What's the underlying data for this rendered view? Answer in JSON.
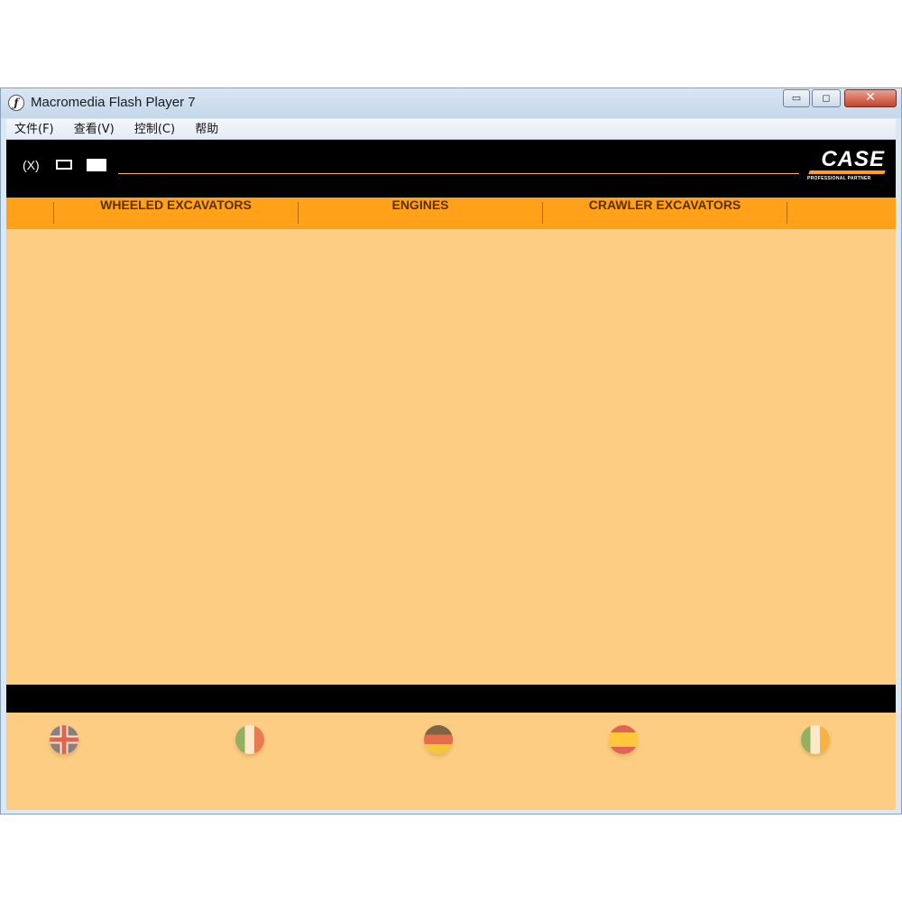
{
  "window": {
    "title": "Macromedia Flash Player 7",
    "minimize_glyph": "▭",
    "maximize_glyph": "◻",
    "close_glyph": "✕"
  },
  "menubar": {
    "items": [
      "文件(F)",
      "查看(V)",
      "控制(C)",
      "帮助"
    ]
  },
  "header": {
    "close_label": "(X)",
    "icons": [
      "fit-screen-icon",
      "fullscreen-icon"
    ],
    "logo_text": "CASE",
    "logo_subtext": "PROFESSIONAL PARTNER"
  },
  "nav": {
    "tabs": [
      "WHEELED EXCAVATORS",
      "ENGINES",
      "CRAWLER EXCAVATORS"
    ]
  },
  "languages": [
    {
      "icon": "uk-flag-icon"
    },
    {
      "icon": "italy-flag-icon"
    },
    {
      "icon": "germany-flag-icon"
    },
    {
      "icon": "spain-flag-icon"
    },
    {
      "icon": "ireland-flag-icon"
    }
  ],
  "colors": {
    "content_bg": "#fdcd83",
    "nav_bg": "#ffa119",
    "header_bg": "#000000",
    "nav_text": "#5a3000"
  }
}
